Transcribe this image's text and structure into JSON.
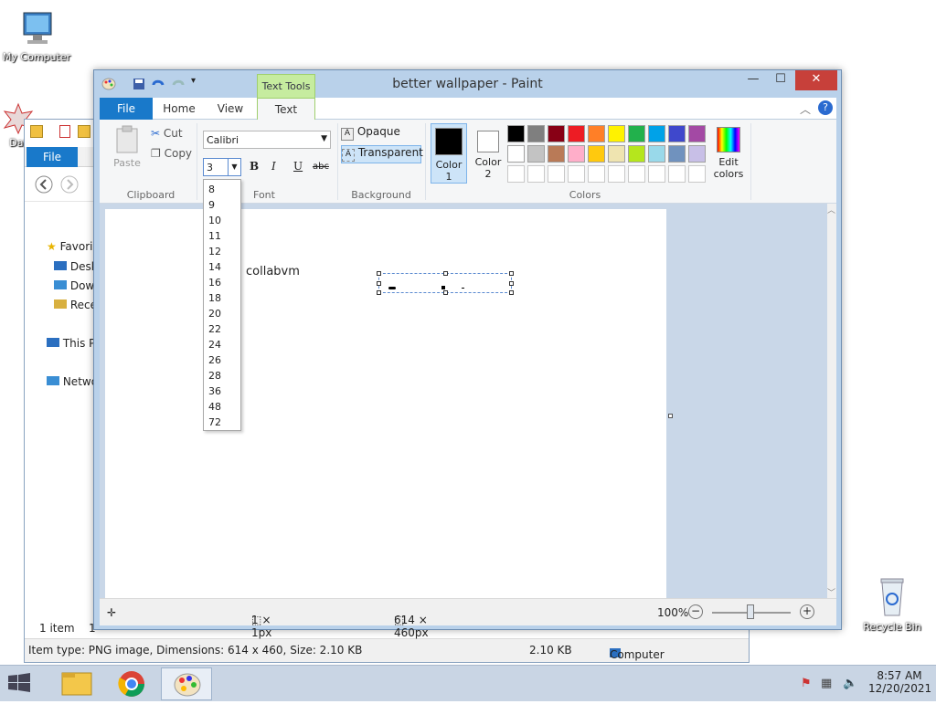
{
  "desktop": {
    "icons": [
      {
        "label": "My Computer"
      },
      {
        "label": "Recycle Bin"
      },
      {
        "label": "Dat"
      }
    ]
  },
  "explorer": {
    "file_tab": "File",
    "nav_items": [
      "Favori",
      "Desk",
      "Dow",
      "Rece",
      "This P",
      "Netwo"
    ],
    "status_left": "1 item",
    "status_left2": "1",
    "bottom_status": "Item type: PNG image, Dimensions: 614 x 460, Size: 2.10 KB",
    "bottom_size": "2.10 KB",
    "bottom_computer": "Computer"
  },
  "paint": {
    "title": "better wallpaper - Paint",
    "text_tools_label": "Text Tools",
    "tabs": {
      "file": "File",
      "home": "Home",
      "view": "View",
      "text": "Text"
    },
    "clipboard": {
      "paste": "Paste",
      "cut": "Cut",
      "copy": "Copy",
      "group": "Clipboard"
    },
    "font": {
      "family": "Calibri",
      "size_value": "3",
      "group": "Font",
      "bold": "B",
      "italic": "I",
      "underline": "U",
      "strike": "abc"
    },
    "background": {
      "opaque": "Opaque",
      "transparent": "Transparent",
      "group": "Background"
    },
    "colors": {
      "color1_label": "Color",
      "color1_num": "1",
      "color2_label": "Color",
      "color2_num": "2",
      "edit_label_1": "Edit",
      "edit_label_2": "colors",
      "group": "Colors",
      "color1": "#000000",
      "color2": "#ffffff",
      "palette_row1": [
        "#000000",
        "#7f7f7f",
        "#880015",
        "#ed1c24",
        "#ff7f27",
        "#fff200",
        "#22b14c",
        "#00a2e8",
        "#3f48cc",
        "#a349a4"
      ],
      "palette_row2": [
        "#ffffff",
        "#c3c3c3",
        "#b97a57",
        "#ffaec9",
        "#ffc90e",
        "#efe4b0",
        "#b5e61d",
        "#99d9ea",
        "#7092be",
        "#c8bfe7"
      ]
    },
    "font_sizes": [
      "8",
      "9",
      "10",
      "11",
      "12",
      "14",
      "16",
      "18",
      "20",
      "22",
      "24",
      "26",
      "28",
      "36",
      "48",
      "72"
    ],
    "canvas_text": "collabvm",
    "status": {
      "selection": "1 × 1px",
      "image_size": "614 × 460px",
      "zoom": "100%"
    }
  },
  "taskbar": {
    "time": "8:57 AM",
    "date": "12/20/2021"
  }
}
